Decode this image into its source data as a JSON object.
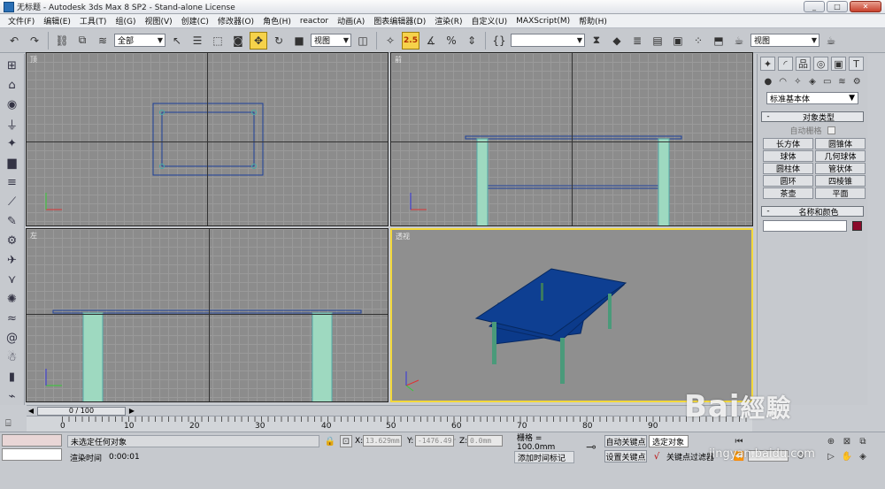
{
  "window": {
    "title": "无标题 - Autodesk 3ds Max 8 SP2  - Stand-alone License",
    "buttons": [
      "_",
      "□",
      "✕"
    ]
  },
  "menu": [
    "文件(F)",
    "编辑(E)",
    "工具(T)",
    "组(G)",
    "视图(V)",
    "创建(C)",
    "修改器(O)",
    "角色(H)",
    "reactor",
    "动画(A)",
    "图表编辑器(D)",
    "渲染(R)",
    "自定义(U)",
    "MAXScript(M)",
    "帮助(H)"
  ],
  "toolbar": {
    "selection_filter": "全部",
    "ref_coord": "视图",
    "named_selection": "",
    "view_dropdown": "视图",
    "snap_label": "2.5"
  },
  "viewports": {
    "top": "顶",
    "front": "前",
    "left": "左",
    "perspective": "透视"
  },
  "command_panel": {
    "category": "标准基本体",
    "object_type_title": "对象类型",
    "autogrid": "自动栅格",
    "objects": [
      "长方体",
      "圆锥体",
      "球体",
      "几何球体",
      "圆柱体",
      "管状体",
      "圆环",
      "四棱锥",
      "茶壶",
      "平面"
    ],
    "name_color_title": "名称和颜色",
    "object_color": "#8b0a2a"
  },
  "timeline": {
    "frame_display": "0 / 100",
    "ticks": [
      "0",
      "10",
      "20",
      "30",
      "40",
      "50",
      "60",
      "70",
      "80",
      "90"
    ]
  },
  "status": {
    "selection": "未选定任何对象",
    "render_time_label": "渲染时间",
    "render_time": "0:00:01",
    "x_label": "X:",
    "x_value": "13.629mm",
    "y_label": "Y:",
    "y_value": "-1476.49r",
    "z_label": "Z:",
    "z_value": "0.0mm",
    "grid": "栅格 = 100.0mm",
    "add_time_tag": "添加时间标记",
    "auto_key": "自动关键点",
    "set_key": "设置关键点",
    "selected_object": "选定对象",
    "key_filters": "关键点过滤器"
  },
  "watermark": {
    "logo": "Bai 经验",
    "url": "jingyan.baidu.com"
  }
}
